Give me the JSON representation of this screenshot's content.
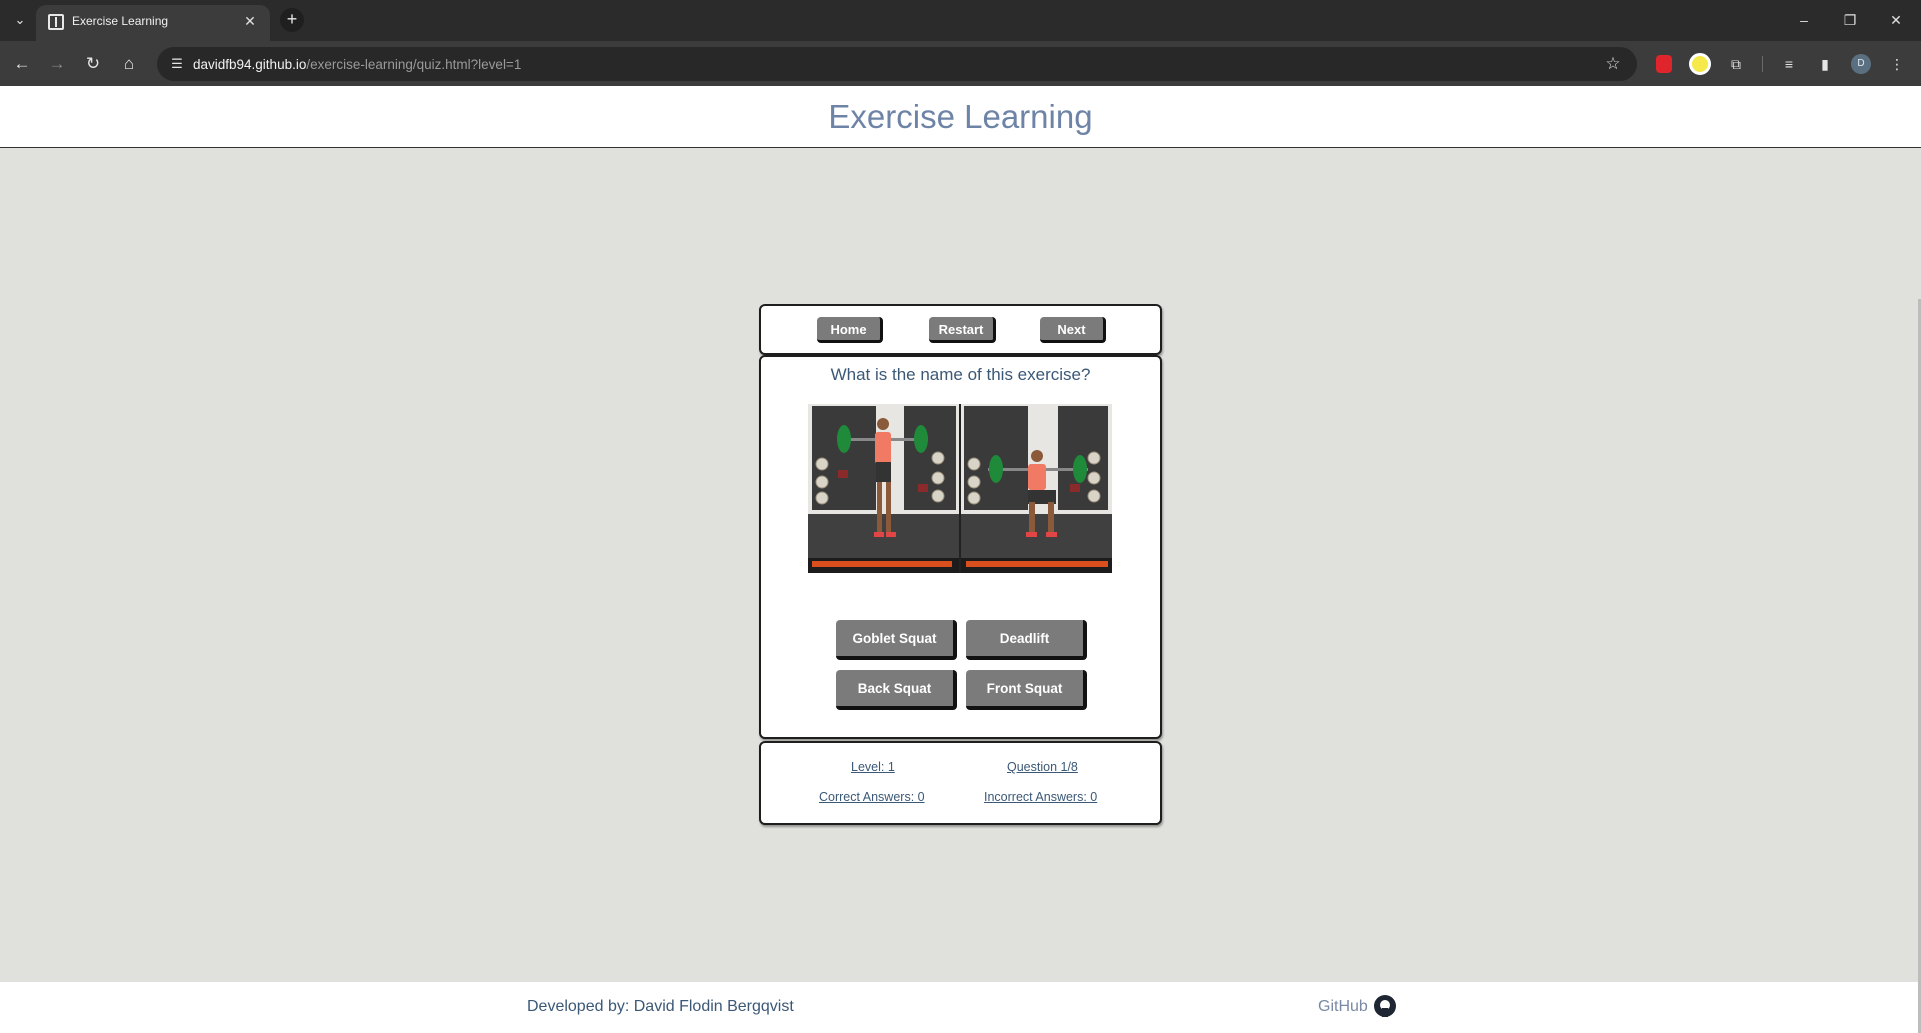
{
  "browser": {
    "tab_title": "Exercise Learning",
    "url_host": "davidfb94.github.io",
    "url_path": "/exercise-learning/quiz.html?level=1",
    "profile_initial": "D"
  },
  "header": {
    "title": "Exercise Learning"
  },
  "quiz_nav": {
    "home": "Home",
    "restart": "Restart",
    "next": "Next"
  },
  "quiz": {
    "question": "What is the name of this exercise?",
    "answers": [
      "Goblet Squat",
      "Deadlift",
      "Back Squat",
      "Front Squat"
    ]
  },
  "stats": {
    "level": "Level:  1",
    "question": "Question  1/8",
    "correct": "Correct Answers:  0",
    "incorrect": "Incorrect Answers:  0"
  },
  "footer": {
    "developer": "Developed by: David Flodin Bergqvist",
    "github": "GitHub"
  },
  "colors": {
    "button": "#7b7b7b",
    "title": "#6e84a6",
    "text": "#3b5876",
    "page_bg": "#e0e0dc"
  }
}
